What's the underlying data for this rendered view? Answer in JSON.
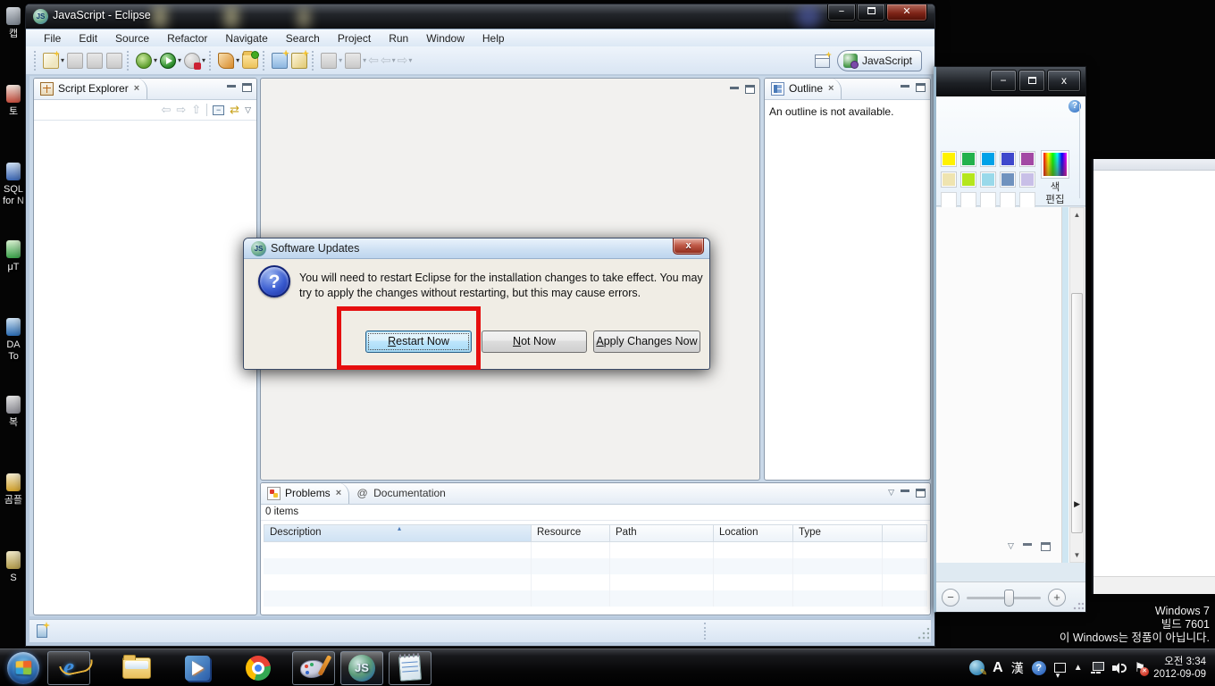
{
  "eclipse": {
    "title": "JavaScript - Eclipse",
    "app_icon_text": "JS",
    "window_buttons": {
      "minimize": "−",
      "maximize": "",
      "close": "✕"
    },
    "menus": [
      "File",
      "Edit",
      "Source",
      "Refactor",
      "Navigate",
      "Search",
      "Project",
      "Run",
      "Window",
      "Help"
    ],
    "perspective_label": "JavaScript",
    "script_explorer": {
      "title": "Script Explorer",
      "close": "×"
    },
    "outline": {
      "title": "Outline",
      "close": "×",
      "empty_message": "An outline is not available."
    },
    "problems": {
      "tab": "Problems",
      "tab_close": "×",
      "doc_tab": "Documentation",
      "doc_at": "@",
      "items_count": "0 items",
      "columns": [
        "Description",
        "Resource",
        "Path",
        "Location",
        "Type"
      ],
      "sort_indicator": "▴"
    }
  },
  "dialog": {
    "title": "Software Updates",
    "close": "x",
    "icon_glyph": "?",
    "message": "You will need to restart Eclipse for the installation changes to take effect. You may try to apply the changes without restarting, but this may cause errors.",
    "buttons": [
      {
        "mnemonic": "R",
        "rest": "estart Now"
      },
      {
        "mnemonic": "N",
        "rest": "ot Now"
      },
      {
        "mnemonic": "A",
        "rest": "pply Changes Now"
      }
    ],
    "highlight_color": "#e60f0f"
  },
  "paint": {
    "window_buttons": {
      "minimize": "−",
      "close": "x"
    },
    "help_glyph": "?",
    "palette_row1": [
      "#fff200",
      "#22b14c",
      "#00a2e8",
      "#3f48cc",
      "#a349a4"
    ],
    "palette_row2": [
      "#efe4b0",
      "#b5e61d",
      "#99d9ea",
      "#7092be",
      "#c8bfe7"
    ],
    "edit_colors_line1": "색",
    "edit_colors_line2": "편집",
    "zoom_minus": "−",
    "zoom_plus": "+",
    "scroll_up": "▲",
    "scroll_down": "▼",
    "pane_arrow": "▶"
  },
  "desktop": {
    "genuine_line1": "Windows 7",
    "genuine_line2": "빌드 7601",
    "genuine_line3": "이 Windows는 정품이 아닙니다.",
    "icons": [
      {
        "label": "캡"
      },
      {
        "label": "토"
      },
      {
        "label": "SQL\nfor N"
      },
      {
        "label": "μT"
      },
      {
        "label": "DA\nTo"
      },
      {
        "label": "복"
      },
      {
        "label": "곰플"
      },
      {
        "label": "S"
      }
    ]
  },
  "taskbar": {
    "js_badge": "JS",
    "tray": {
      "ime_a": "A",
      "ime_han": "漢",
      "help_glyph": "?",
      "flag_glyph": "⚑",
      "flag_badge": "✕",
      "time": "오전 3:34",
      "date": "2012-09-09"
    }
  }
}
